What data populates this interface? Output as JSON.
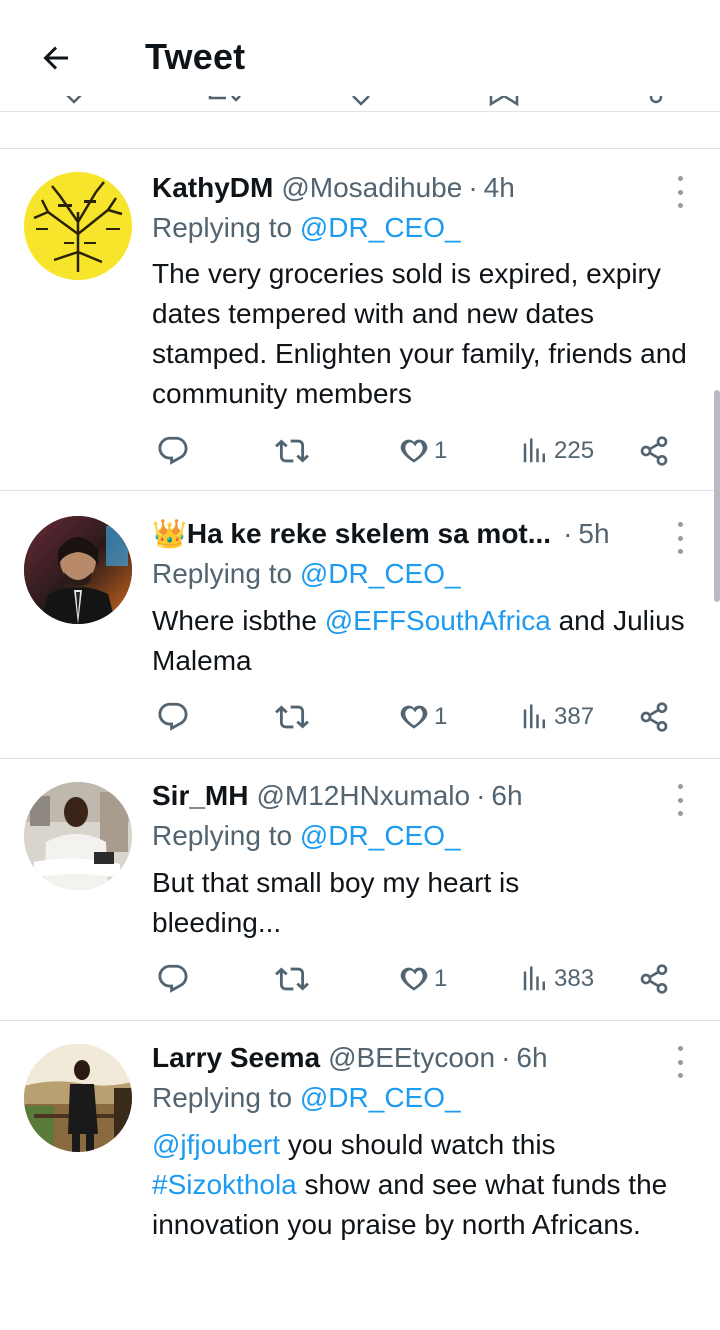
{
  "header": {
    "title": "Tweet"
  },
  "replying_label": "Replying to",
  "tweets": [
    {
      "name": "KathyDM",
      "handle": "@Mosadihube",
      "time": "4h",
      "reply_to": "@DR_CEO_",
      "text": "The very groceries sold is expired, expiry dates tempered with and new dates stamped. Enlighten your family, friends and community members",
      "likes": "1",
      "views": "225"
    },
    {
      "name": "👑Ha ke reke skelem sa mot...",
      "handle": "",
      "time": "5h",
      "reply_to": "@DR_CEO_",
      "text_part1": "Where isbthe ",
      "mention": "@EFFSouthAfrica",
      "text_part2": " and Julius Malema",
      "likes": "1",
      "views": "387"
    },
    {
      "name": "Sir_MH",
      "handle": "@M12HNxumalo",
      "time": "6h",
      "reply_to": "@DR_CEO_",
      "text": "But that small boy my heart is bleeding...",
      "likes": "1",
      "views": "383"
    },
    {
      "name": "Larry Seema",
      "handle": "@BEEtycoon",
      "time": "6h",
      "reply_to": "@DR_CEO_",
      "mention": "@jfjoubert",
      "text_part1": " you should watch this ",
      "hashtag": "#Sizokthola",
      "text_part2": " show and see what funds the innovation you praise by north Africans."
    }
  ],
  "colors": {
    "link": "#1d9bf0",
    "secondary": "#536471",
    "divider": "#dfe3e6"
  }
}
